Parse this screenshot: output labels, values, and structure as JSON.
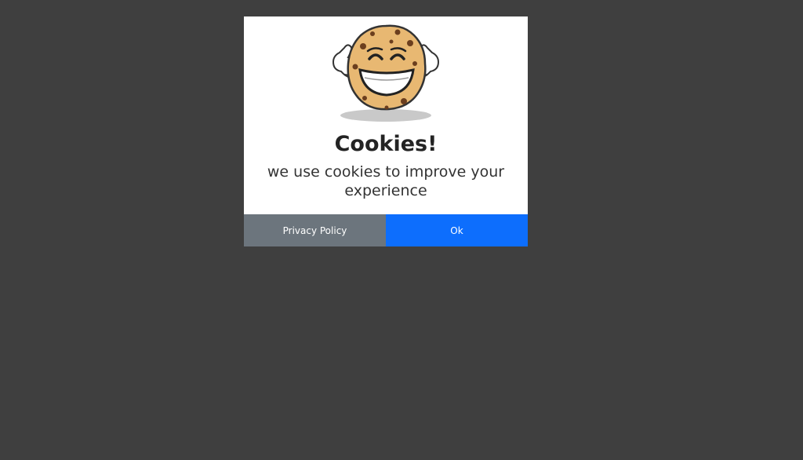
{
  "modal": {
    "title": "Cookies!",
    "message": "we use cookies to improve your experience",
    "privacy_label": "Privacy Policy",
    "ok_label": "Ok",
    "mascot_icon": "smiling-cookie-thumbs-up-icon"
  },
  "colors": {
    "backdrop": "#3f3f3f",
    "privacy_button": "#6c757d",
    "ok_button": "#0d6efd"
  }
}
